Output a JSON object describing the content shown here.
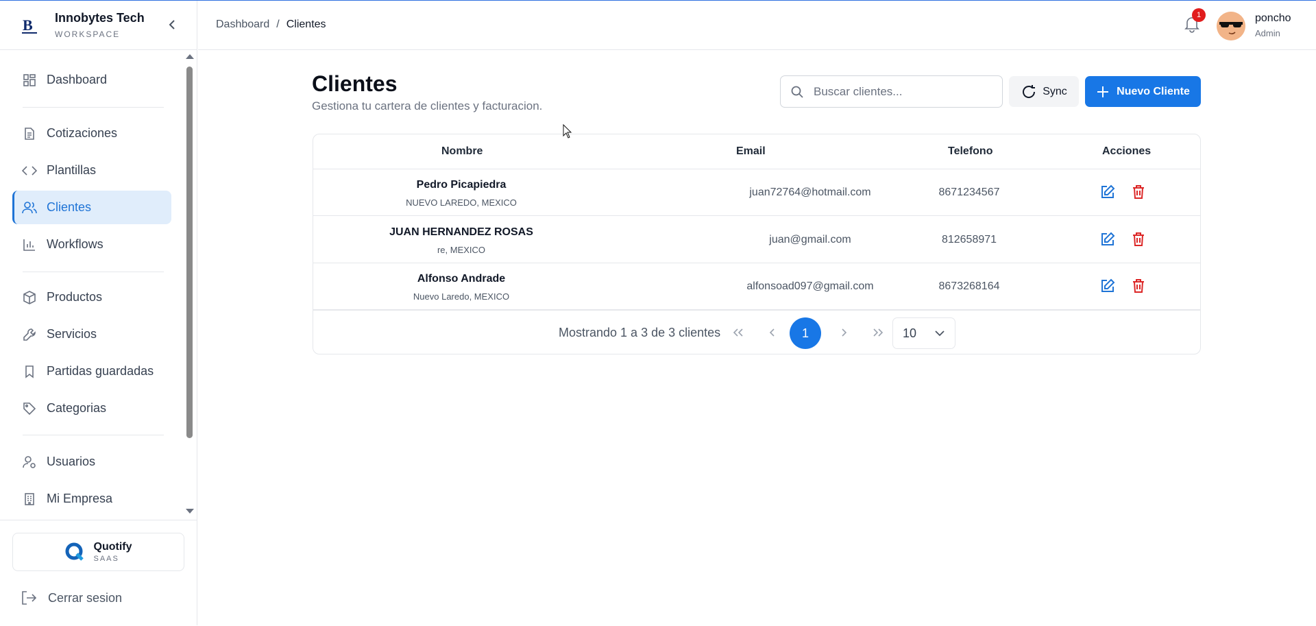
{
  "brand": {
    "name": "Innobytes Tech",
    "subtitle": "WORKSPACE"
  },
  "nav": {
    "items": [
      {
        "label": "Dashboard",
        "icon": "grid-icon"
      },
      {
        "label": "Cotizaciones",
        "icon": "document-icon"
      },
      {
        "label": "Plantillas",
        "icon": "code-icon"
      },
      {
        "label": "Clientes",
        "icon": "users-icon",
        "active": true
      },
      {
        "label": "Workflows",
        "icon": "bar-chart-icon"
      },
      {
        "label": "Productos",
        "icon": "box-icon"
      },
      {
        "label": "Servicios",
        "icon": "wrench-icon"
      },
      {
        "label": "Partidas guardadas",
        "icon": "bookmark-icon"
      },
      {
        "label": "Categorias",
        "icon": "tag-icon"
      },
      {
        "label": "Usuarios",
        "icon": "user-settings-icon"
      },
      {
        "label": "Mi Empresa",
        "icon": "building-icon"
      }
    ]
  },
  "footer": {
    "app_name": "Quotify",
    "app_sub": "SAAS",
    "logout": "Cerrar sesion"
  },
  "breadcrumb": {
    "root": "Dashboard",
    "sep": "/",
    "current": "Clientes"
  },
  "user": {
    "name": "poncho",
    "role": "Admin",
    "notifications": "1"
  },
  "page": {
    "title": "Clientes",
    "subtitle": "Gestiona tu cartera de clientes y facturacion."
  },
  "search": {
    "placeholder": "Buscar clientes..."
  },
  "buttons": {
    "sync": "Sync",
    "new_client": "Nuevo Cliente"
  },
  "table": {
    "headers": {
      "name": "Nombre",
      "email": "Email",
      "phone": "Telefono",
      "actions": "Acciones"
    },
    "rows": [
      {
        "name": "Pedro Picapiedra",
        "location": "NUEVO LAREDO, MEXICO",
        "email": "juan72764@hotmail.com",
        "phone": "8671234567"
      },
      {
        "name": "JUAN HERNANDEZ ROSAS",
        "location": "re, MEXICO",
        "email": "juan@gmail.com",
        "phone": "812658971"
      },
      {
        "name": "Alfonso Andrade",
        "location": "Nuevo Laredo, MEXICO",
        "email": "alfonsoad097@gmail.com",
        "phone": "8673268164"
      }
    ]
  },
  "pagination": {
    "summary": "Mostrando 1 a 3 de 3 clientes",
    "current_page": "1",
    "per_page": "10"
  },
  "colors": {
    "accent": "#1877e6",
    "danger": "#dc2626",
    "active_bg": "#e0edfb"
  }
}
